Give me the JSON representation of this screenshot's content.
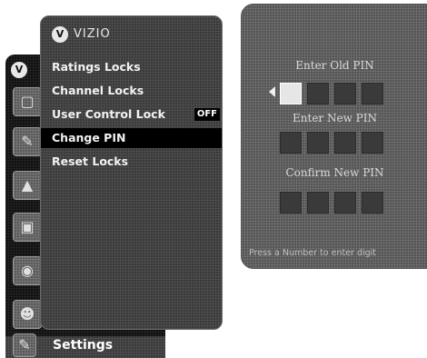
{
  "brand": {
    "logo_letter": "V",
    "name": "VIZIO"
  },
  "back_menu": {
    "tab_char": "V",
    "icons": [
      "tv-icon",
      "wrench-icon",
      "antenna-icon",
      "picture-icon",
      "audio-icon",
      "people-icon"
    ],
    "settings_label": "Settings"
  },
  "submenu": {
    "items": [
      {
        "label": "Ratings Locks"
      },
      {
        "label": "Channel Locks"
      },
      {
        "label": "User Control Lock",
        "value": "OFF"
      },
      {
        "label": "Change PIN",
        "selected": true
      },
      {
        "label": "Reset Locks"
      }
    ]
  },
  "pin_panel": {
    "old_pin_label": "Enter Old PIN",
    "new_pin_label": "Enter New PIN",
    "confirm_pin_label": "Confirm New PIN",
    "hint": "Press a Number to enter digit"
  }
}
